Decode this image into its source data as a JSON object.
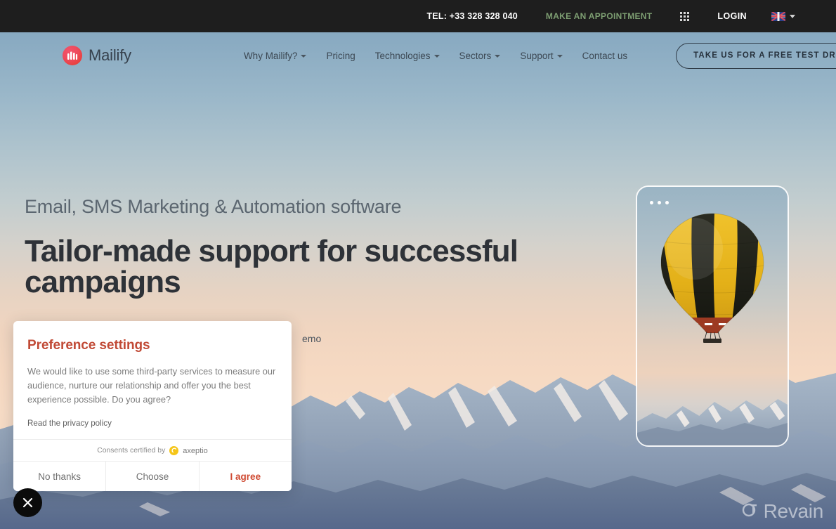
{
  "topbar": {
    "phone": "TEL: +33 328 328 040",
    "appointment": "MAKE AN APPOINTMENT",
    "apps_icon": "grid-apps-icon",
    "login": "LOGIN",
    "language_flag": "uk-flag-icon",
    "language_caret": "chevron-down-icon",
    "appointment_color": "#7d9e72",
    "background": "#1e1e1e"
  },
  "nav": {
    "logo_text": "Mailify",
    "logo_icon": "mailify-logo-icon",
    "items": [
      {
        "label": "Why Mailify?",
        "has_dropdown": true
      },
      {
        "label": "Pricing",
        "has_dropdown": false
      },
      {
        "label": "Technologies",
        "has_dropdown": true
      },
      {
        "label": "Sectors",
        "has_dropdown": true
      },
      {
        "label": "Support",
        "has_dropdown": true
      },
      {
        "label": "Contact us",
        "has_dropdown": false
      }
    ],
    "cta": "TAKE US FOR A FREE TEST DRIVE"
  },
  "hero": {
    "subtitle": "Email, SMS Marketing & Automation software",
    "title": "Tailor-made support for successful campaigns",
    "links_partial": "emo",
    "card": {
      "dots_icon": "more-options-icon",
      "image_alt": "hot-air-balloon-photo"
    }
  },
  "consent": {
    "title": "Preference settings",
    "body": "We would like to use some third-party services to measure our audience, nurture our relationship and offer you the best experience possible. Do you agree?",
    "policy_link": "Read the privacy policy",
    "certified_prefix": "Consents certified by",
    "certified_brand": "axeptio",
    "buttons": [
      {
        "label": "No thanks",
        "style": "plain"
      },
      {
        "label": "Choose",
        "style": "plain"
      },
      {
        "label": "I agree",
        "style": "accent"
      }
    ],
    "title_color": "#c14a36",
    "accent_color": "#cf4a32"
  },
  "overlay": {
    "close_icon": "close-icon",
    "watermark_text": "Revain",
    "watermark_icon": "revain-logo-icon"
  }
}
